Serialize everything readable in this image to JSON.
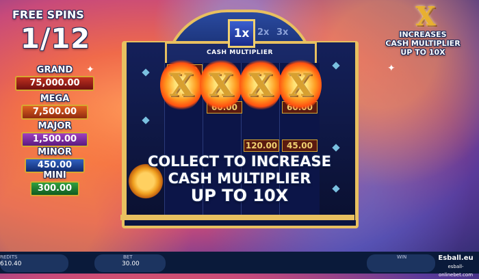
{
  "free_spins": {
    "label": "FREE SPINS",
    "count": "1/12"
  },
  "jackpots": [
    {
      "name": "GRAND",
      "value": "75,000.00"
    },
    {
      "name": "MEGA",
      "value": "7,500.00"
    },
    {
      "name": "MAJOR",
      "value": "1,500.00"
    },
    {
      "name": "MINOR",
      "value": "450.00"
    },
    {
      "name": "MINI",
      "value": "300.00"
    }
  ],
  "multiplier": {
    "current": "1x",
    "next": [
      "2x",
      "3x"
    ],
    "caption": "CASH MULTIPLIER"
  },
  "reels": {
    "cash_values": [
      "45.00",
      "60.00",
      "60.00",
      "120.00",
      "45.00"
    ],
    "symbols": [
      "X",
      "X",
      "X",
      "X"
    ]
  },
  "message": {
    "line1": "COLLECT TO INCREASE",
    "line2": "CASH MULTIPLIER",
    "line3": "UP TO 10X"
  },
  "info": {
    "symbol": "X",
    "line1": "INCREASES",
    "line2": "CASH MULTIPLIER",
    "line3": "UP TO 10X"
  },
  "bottom_bar": {
    "credits_label": "REDITS",
    "credits_value": "610.40",
    "bet_label": "BET",
    "bet_value": "30.00",
    "win_label": "WIN"
  },
  "watermark": {
    "brand": "Esball.eu",
    "url": "esball-onlinebet.com"
  },
  "colors": {
    "gold": "#e8c060",
    "frame_blue": "#10225a",
    "bar": "#0a1a3a"
  }
}
